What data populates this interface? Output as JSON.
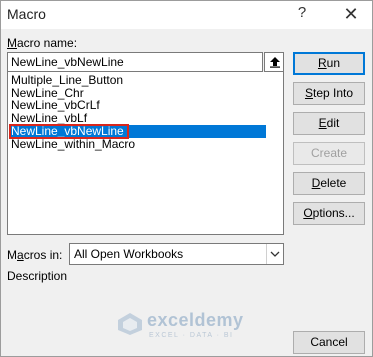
{
  "window": {
    "title": "Macro",
    "help_label": "?",
    "close_label": "✕"
  },
  "macro_name": {
    "label_prefix": "",
    "label_access": "M",
    "label_rest": "acro name:",
    "value": "NewLine_vbNewLine"
  },
  "macro_list": {
    "items": [
      {
        "label": "Multiple_Line_Button",
        "selected": false
      },
      {
        "label": "NewLine_Chr",
        "selected": false
      },
      {
        "label": "NewLine_vbCrLf",
        "selected": false
      },
      {
        "label": "NewLine_vbLf",
        "selected": false
      },
      {
        "label": "NewLine_vbNewLine",
        "selected": true
      },
      {
        "label": "NewLine_within_Macro",
        "selected": false
      }
    ]
  },
  "buttons": {
    "run": {
      "pre": "",
      "acc": "R",
      "post": "un"
    },
    "step_into": {
      "pre": "",
      "acc": "S",
      "post": "tep Into"
    },
    "edit": {
      "pre": "",
      "acc": "E",
      "post": "dit"
    },
    "create": {
      "label": "Create"
    },
    "delete": {
      "pre": "",
      "acc": "D",
      "post": "elete"
    },
    "options": {
      "pre": "",
      "acc": "O",
      "post": "ptions..."
    },
    "cancel": {
      "label": "Cancel"
    }
  },
  "macros_in": {
    "label_pre": "M",
    "label_acc": "a",
    "label_post": "cros in:",
    "value": "All Open Workbooks"
  },
  "description": {
    "label": "Description"
  },
  "watermark": {
    "name": "exceldemy",
    "tagline": "EXCEL · DATA · BI"
  },
  "colors": {
    "selection": "#0078d7",
    "highlight_outline": "#d9261c",
    "dialog_bg": "#f0f0f0"
  }
}
